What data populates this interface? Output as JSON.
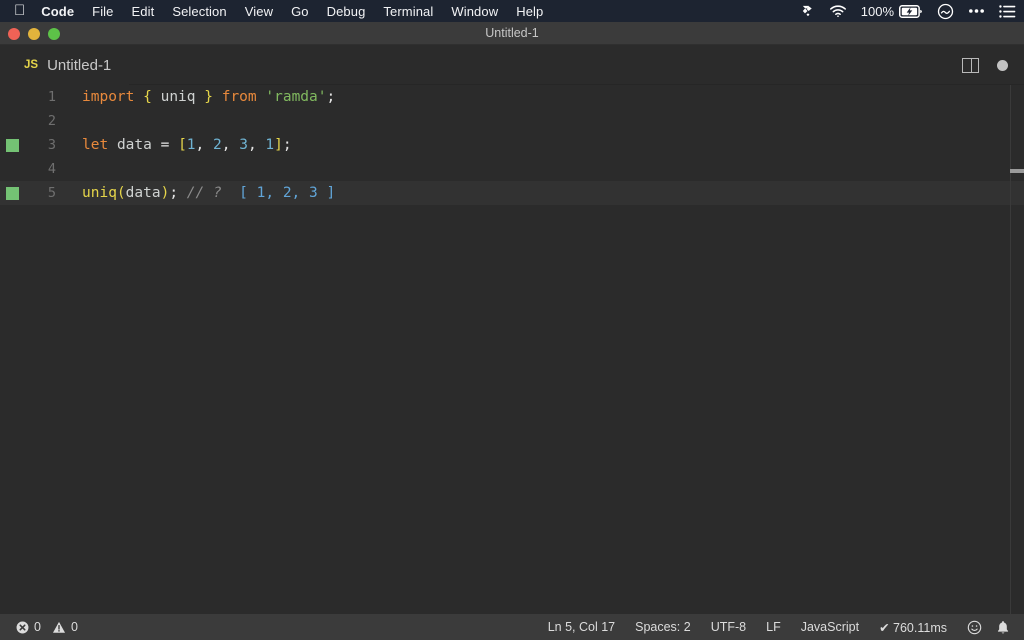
{
  "menubar": {
    "apple_glyph": "",
    "items": [
      {
        "label": "Code",
        "bold": true
      },
      {
        "label": "File",
        "bold": false
      },
      {
        "label": "Edit",
        "bold": false
      },
      {
        "label": "Selection",
        "bold": false
      },
      {
        "label": "View",
        "bold": false
      },
      {
        "label": "Go",
        "bold": false
      },
      {
        "label": "Debug",
        "bold": false
      },
      {
        "label": "Terminal",
        "bold": false
      },
      {
        "label": "Window",
        "bold": false
      },
      {
        "label": "Help",
        "bold": false
      }
    ],
    "status_icons": [
      "dropbox-icon",
      "wifi-icon",
      "battery-charging-icon",
      "spotlight-icon",
      "control-center-icon",
      "notification-center-icon"
    ],
    "battery_percent": "100%",
    "background": "#1d2431"
  },
  "window": {
    "title": "Untitled-1",
    "traffic_lights": [
      "close",
      "minimize",
      "zoom"
    ]
  },
  "tabbar": {
    "tab": {
      "badge": "JS",
      "label": "Untitled-1",
      "badge_color": "#e5d54a"
    },
    "actions": [
      "split-editor-icon",
      "unsaved-dot-icon"
    ]
  },
  "editor": {
    "lines": [
      {
        "number": "1",
        "marker": false,
        "active": false,
        "tokens": [
          {
            "text": "import",
            "kind": "kw"
          },
          {
            "text": " ",
            "kind": "plain"
          },
          {
            "text": "{",
            "kind": "brace"
          },
          {
            "text": " ",
            "kind": "plain"
          },
          {
            "text": "uniq",
            "kind": "var"
          },
          {
            "text": " ",
            "kind": "plain"
          },
          {
            "text": "}",
            "kind": "brace"
          },
          {
            "text": " ",
            "kind": "plain"
          },
          {
            "text": "from",
            "kind": "kw"
          },
          {
            "text": " ",
            "kind": "plain"
          },
          {
            "text": "'ramda'",
            "kind": "str"
          },
          {
            "text": ";",
            "kind": "punc"
          }
        ]
      },
      {
        "number": "2",
        "marker": false,
        "active": false,
        "tokens": []
      },
      {
        "number": "3",
        "marker": true,
        "active": false,
        "tokens": [
          {
            "text": "let",
            "kind": "kw"
          },
          {
            "text": " ",
            "kind": "plain"
          },
          {
            "text": "data",
            "kind": "var"
          },
          {
            "text": " ",
            "kind": "plain"
          },
          {
            "text": "=",
            "kind": "punc"
          },
          {
            "text": " ",
            "kind": "plain"
          },
          {
            "text": "[",
            "kind": "brace"
          },
          {
            "text": "1",
            "kind": "num"
          },
          {
            "text": ", ",
            "kind": "punc"
          },
          {
            "text": "2",
            "kind": "num"
          },
          {
            "text": ", ",
            "kind": "punc"
          },
          {
            "text": "3",
            "kind": "num"
          },
          {
            "text": ", ",
            "kind": "punc"
          },
          {
            "text": "1",
            "kind": "num"
          },
          {
            "text": "]",
            "kind": "brace"
          },
          {
            "text": ";",
            "kind": "punc"
          }
        ]
      },
      {
        "number": "4",
        "marker": false,
        "active": false,
        "tokens": []
      },
      {
        "number": "5",
        "marker": true,
        "active": true,
        "tokens": [
          {
            "text": "uniq",
            "kind": "fn"
          },
          {
            "text": "(",
            "kind": "brace"
          },
          {
            "text": "data",
            "kind": "var"
          },
          {
            "text": ")",
            "kind": "brace"
          },
          {
            "text": ";",
            "kind": "punc"
          },
          {
            "text": " ",
            "kind": "plain"
          },
          {
            "text": "// ?",
            "kind": "cmt"
          },
          {
            "text": "  ",
            "kind": "plain"
          },
          {
            "text": "[ 1, 2, 3 ]",
            "kind": "res"
          }
        ]
      }
    ],
    "marker_color": "#74c274",
    "background": "#2b2b2b"
  },
  "statusbar": {
    "errors": "0",
    "warnings": "0",
    "cursor": "Ln 5, Col 17",
    "indentation": "Spaces: 2",
    "encoding": "UTF-8",
    "eol": "LF",
    "language": "JavaScript",
    "run_time": "✔ 760.11ms",
    "icons": [
      "error-icon",
      "warning-icon",
      "feedback-smiley-icon",
      "bell-icon"
    ]
  }
}
